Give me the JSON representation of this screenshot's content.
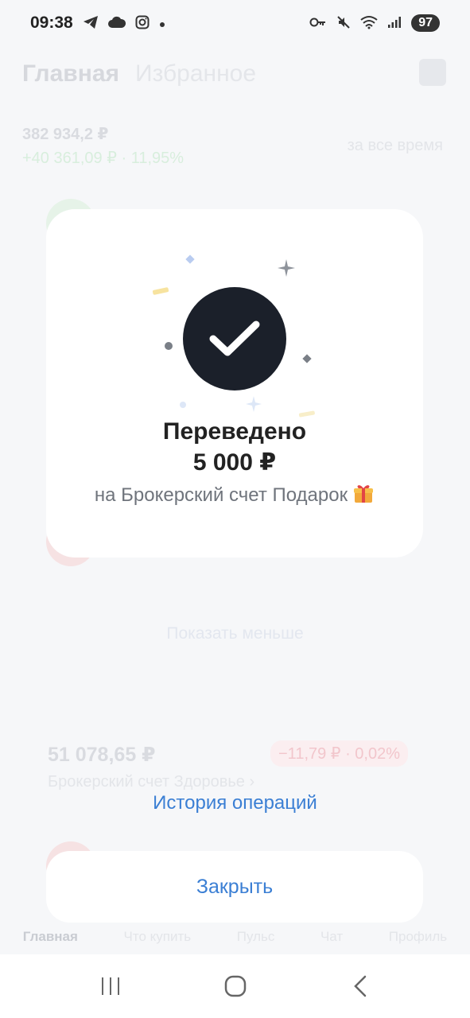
{
  "status_bar": {
    "time": "09:38",
    "battery": "97",
    "left_icons": [
      "telegram-icon",
      "cloud-icon",
      "instagram-icon",
      "dot-icon"
    ],
    "right_icons": [
      "key-icon",
      "mute-icon",
      "wifi-icon",
      "signal-icon"
    ]
  },
  "background": {
    "tabs": [
      "Главная",
      "Избранное"
    ],
    "total": "382 934,2 ₽",
    "change": "+40 361,09 ₽ · 11,95%",
    "period": "за все время",
    "show_less": "Показать меньше",
    "account": {
      "sum": "51 078,65 ₽",
      "change": "−11,79 ₽ · 0,02%",
      "name": "Брокерский счет Здоровье ›"
    },
    "bottom_nav": [
      "Главная",
      "Что купить",
      "Пульс",
      "Чат",
      "Профиль"
    ]
  },
  "dialog": {
    "title": "Переведено",
    "amount": "5 000 ₽",
    "subtitle": "на Брокерский счет Подарок",
    "icon": "check-icon"
  },
  "history_link": "История операций",
  "close_button": "Закрыть",
  "colors": {
    "accent": "#3b7fd4",
    "check_bg": "#1b202a"
  }
}
